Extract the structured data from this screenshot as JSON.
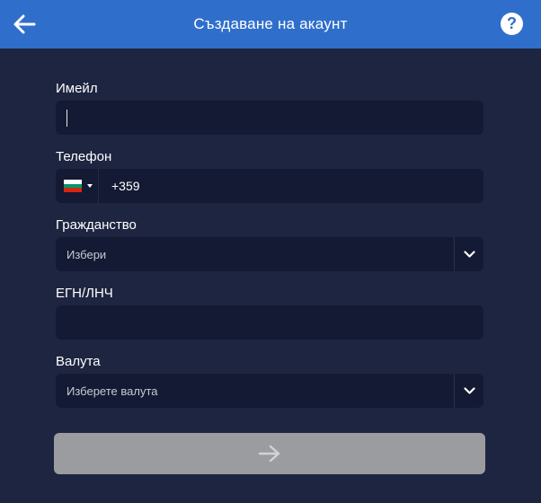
{
  "header": {
    "title": "Създаване на акаунт",
    "back_icon": "arrow-left-icon",
    "help_icon": "question-circle-icon",
    "help_glyph": "?"
  },
  "form": {
    "email": {
      "label": "Имейл",
      "value": ""
    },
    "phone": {
      "label": "Телефон",
      "country_code": "+359",
      "flag_icon": "bulgaria-flag-icon",
      "flag_colors": [
        "#ffffff",
        "#00966e",
        "#d62612"
      ]
    },
    "citizenship": {
      "label": "Гражданство",
      "placeholder": "Избери"
    },
    "egn": {
      "label": "ЕГН/ЛНЧ",
      "value": ""
    },
    "currency": {
      "label": "Валута",
      "placeholder": "Изберете валута"
    }
  },
  "submit": {
    "icon": "arrow-right-icon",
    "disabled": true
  },
  "colors": {
    "header_bg": "#2f6fcb",
    "page_bg": "#1e2540",
    "field_bg": "#141a33",
    "submit_disabled_bg": "#9b9c9f"
  }
}
